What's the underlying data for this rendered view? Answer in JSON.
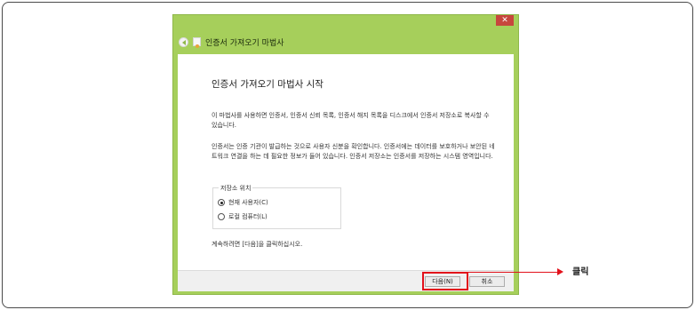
{
  "window": {
    "close_glyph": "✕",
    "title": "인증서 가져오기 마법사"
  },
  "content": {
    "heading": "인증서 가져오기 마법사 시작",
    "paragraph1": "이 마법사를 사용하면 인증서, 인증서 신뢰 목록, 인증서 해지 목록을 디스크에서 인증서 저장소로 복사할 수 있습니다.",
    "paragraph2": "인증서는 인증 기관이 발급하는 것으로 사용자 신분을 확인합니다. 인증서에는 데이터를 보호하거나 보안된 네트워크 연결을 하는 데 필요한 정보가 들어 있습니다. 인증서 저장소는 인증서를 저장하는 시스템 영역입니다.",
    "store_group": {
      "legend": "저장소 위치",
      "options": [
        {
          "label": "현재 사용자(C)",
          "checked": true
        },
        {
          "label": "로컬 컴퓨터(L)",
          "checked": false
        }
      ]
    },
    "footer_note": "계속하려면 [다음]을 클릭하십시오."
  },
  "buttons": {
    "next": "다음(N)",
    "cancel": "취소"
  },
  "annotation": {
    "callout": "클릭",
    "color": "#e2111b"
  }
}
